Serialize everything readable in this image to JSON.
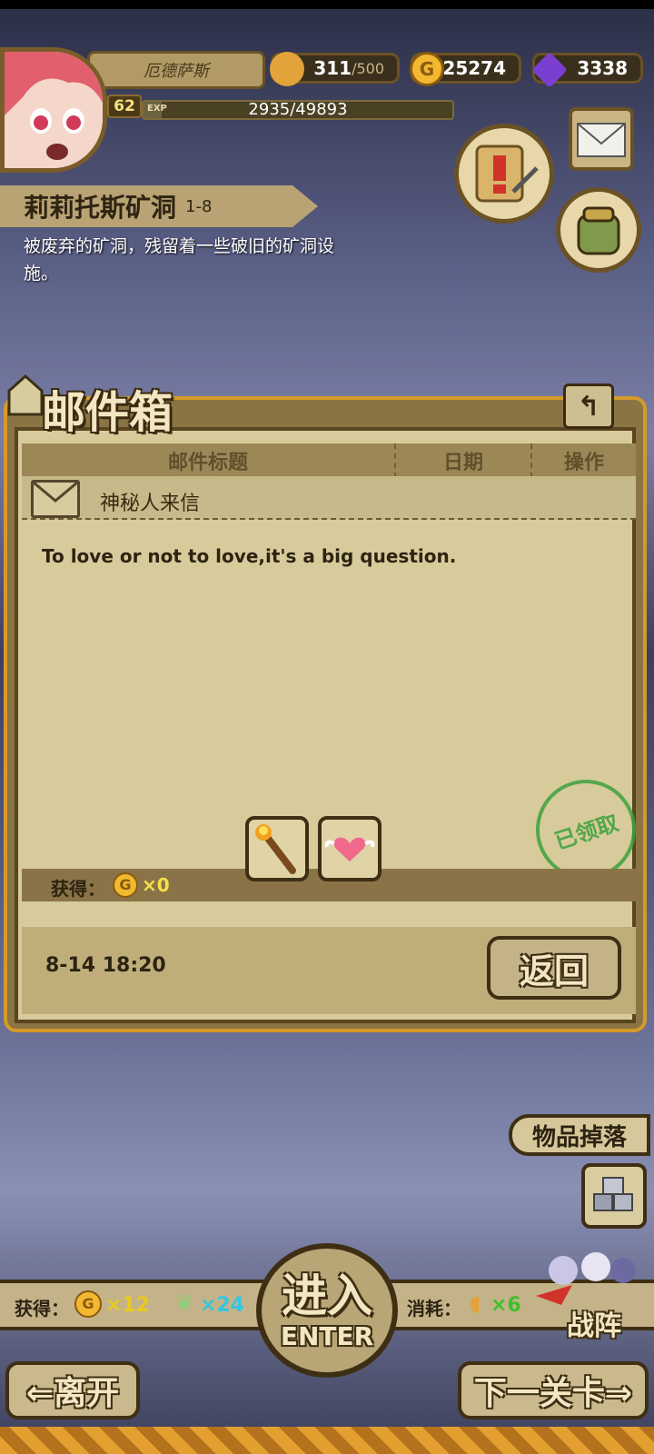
{
  "player": {
    "name": "厄德萨斯",
    "level": "62",
    "exp_tag": "EXP",
    "exp_text": "2935/49893",
    "exp_progress": 0.059
  },
  "resources": {
    "bread_current": "311",
    "bread_max": "/500",
    "gold": "25274",
    "gem": "3338"
  },
  "stage": {
    "name": "莉莉托斯矿洞",
    "number": "1-8",
    "description": "被废弃的矿洞，残留着一些破旧的矿洞设施。"
  },
  "mailbox": {
    "title": "邮件箱",
    "columns": [
      "邮件标题",
      "日期",
      "操作"
    ],
    "sender": "神秘人来信",
    "body": "To love or not to love,it's a big question.",
    "reward_label": "获得：",
    "coin_glyph": "G",
    "reward_gold": "×0",
    "stamp_text": "已领取",
    "date": "8-14 18:20",
    "return_label": "返回"
  },
  "bottom": {
    "drops_label": "物品掉落",
    "gain_label": "获得：",
    "gain_gold": "×12",
    "gain_exp": "×24",
    "cost_label": "消耗：",
    "cost_val": "×6",
    "enter_cn": "进入",
    "enter_en": "ENTER",
    "formation_label": "战阵",
    "leave_label": "⇐离开",
    "next_label": "下一关卡⇒"
  },
  "colors": {
    "accent_gold": "#f2b830",
    "gem_purple": "#7a3fd1",
    "stamp_green": "#3da13d"
  }
}
